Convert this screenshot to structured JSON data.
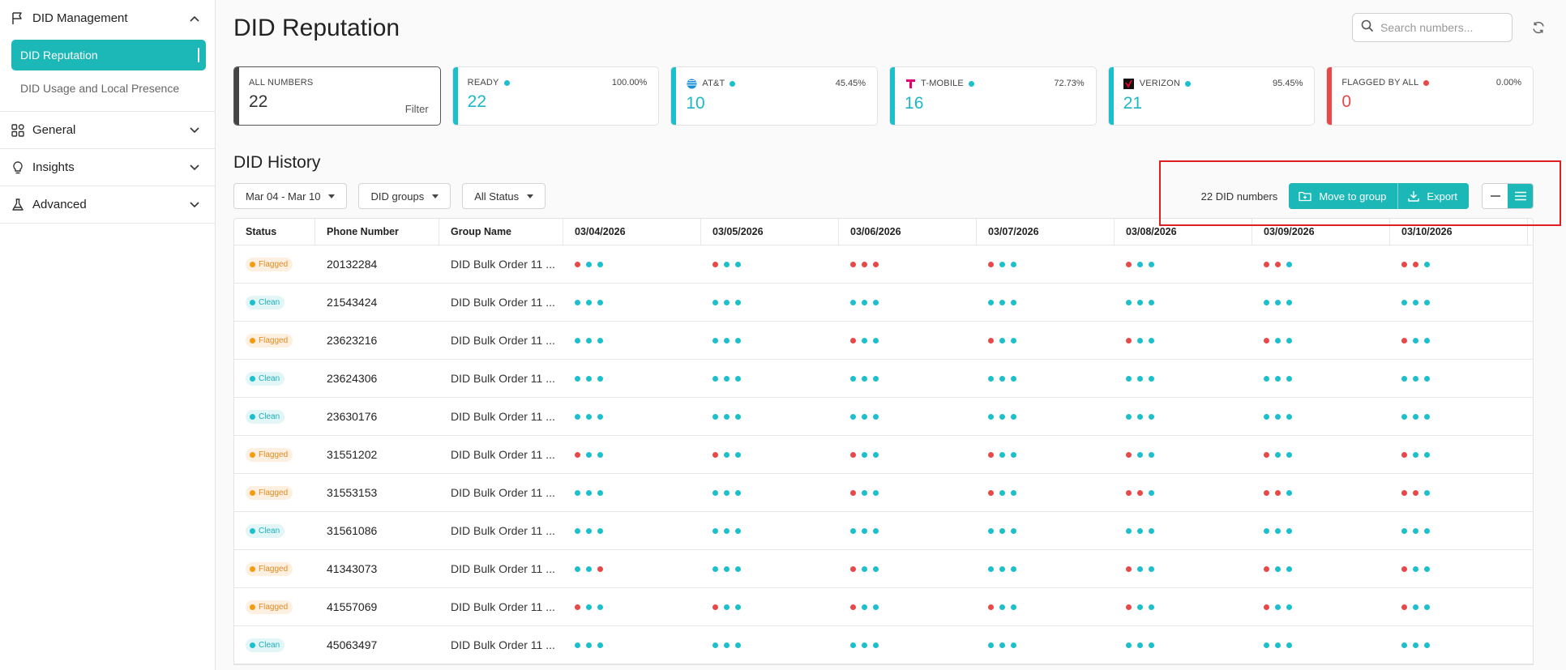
{
  "sidebar": {
    "groups": [
      {
        "label": "DID Management",
        "icon": "flag-icon",
        "expanded": true,
        "items": [
          {
            "label": "DID Reputation",
            "active": true
          },
          {
            "label": "DID Usage and Local Presence",
            "active": false
          }
        ]
      },
      {
        "label": "General",
        "icon": "grid-icon",
        "expanded": false
      },
      {
        "label": "Insights",
        "icon": "lightbulb-icon",
        "expanded": false
      },
      {
        "label": "Advanced",
        "icon": "flask-icon",
        "expanded": false
      }
    ]
  },
  "header": {
    "title": "DID Reputation",
    "search_placeholder": "Search numbers..."
  },
  "cards": [
    {
      "label": "ALL NUMBERS",
      "value": "22",
      "pct": "",
      "action": "Filter",
      "bar": "#444444",
      "dot": "",
      "value_color": "#333333",
      "logo": ""
    },
    {
      "label": "READY",
      "value": "22",
      "pct": "100.00%",
      "bar": "#1cc0cc",
      "dot": "#1cc0cc",
      "value_color": "#1cb8c8",
      "logo": ""
    },
    {
      "label": "AT&T",
      "value": "10",
      "pct": "45.45%",
      "bar": "#1cc0cc",
      "dot": "#1cc0cc",
      "value_color": "#1cb8c8",
      "logo": "att-logo"
    },
    {
      "label": "T-MOBILE",
      "value": "16",
      "pct": "72.73%",
      "bar": "#1cc0cc",
      "dot": "#1cc0cc",
      "value_color": "#1cb8c8",
      "logo": "tmobile-logo"
    },
    {
      "label": "VERIZON",
      "value": "21",
      "pct": "95.45%",
      "bar": "#1cc0cc",
      "dot": "#1cc0cc",
      "value_color": "#1cb8c8",
      "logo": "verizon-logo"
    },
    {
      "label": "FLAGGED BY ALL",
      "value": "0",
      "pct": "0.00%",
      "bar": "#e84848",
      "dot": "#e84848",
      "value_color": "#e84848",
      "logo": ""
    }
  ],
  "history": {
    "title": "DID History",
    "filters": [
      "Mar 04 - Mar 10",
      "DID groups",
      "All Status"
    ],
    "count_label": "22 DID numbers",
    "move_label": "Move to group",
    "export_label": "Export"
  },
  "table": {
    "columns": [
      "Status",
      "Phone Number",
      "Group Name",
      "03/04/2026",
      "03/05/2026",
      "03/06/2026",
      "03/07/2026",
      "03/08/2026",
      "03/09/2026",
      "03/10/2026"
    ],
    "rows": [
      {
        "status": "Flagged",
        "phone": "20132284",
        "group": "DID Bulk Order 11 ...",
        "dots": [
          "rcc",
          "rcc",
          "rrr",
          "rcc",
          "rcc",
          "rrc",
          "rrc"
        ]
      },
      {
        "status": "Clean",
        "phone": "21543424",
        "group": "DID Bulk Order 11 ...",
        "dots": [
          "ccc",
          "ccc",
          "ccc",
          "ccc",
          "ccc",
          "ccc",
          "ccc"
        ]
      },
      {
        "status": "Flagged",
        "phone": "23623216",
        "group": "DID Bulk Order 11 ...",
        "dots": [
          "ccc",
          "ccc",
          "rcc",
          "rcc",
          "rcc",
          "rcc",
          "rcc"
        ]
      },
      {
        "status": "Clean",
        "phone": "23624306",
        "group": "DID Bulk Order 11 ...",
        "dots": [
          "ccc",
          "ccc",
          "ccc",
          "ccc",
          "ccc",
          "ccc",
          "ccc"
        ]
      },
      {
        "status": "Clean",
        "phone": "23630176",
        "group": "DID Bulk Order 11 ...",
        "dots": [
          "ccc",
          "ccc",
          "ccc",
          "ccc",
          "ccc",
          "ccc",
          "ccc"
        ]
      },
      {
        "status": "Flagged",
        "phone": "31551202",
        "group": "DID Bulk Order 11 ...",
        "dots": [
          "rcc",
          "rcc",
          "rcc",
          "rcc",
          "rcc",
          "rcc",
          "rcc"
        ]
      },
      {
        "status": "Flagged",
        "phone": "31553153",
        "group": "DID Bulk Order 11 ...",
        "dots": [
          "ccc",
          "ccc",
          "rcc",
          "rcc",
          "rrc",
          "rrc",
          "rrc"
        ]
      },
      {
        "status": "Clean",
        "phone": "31561086",
        "group": "DID Bulk Order 11 ...",
        "dots": [
          "ccc",
          "ccc",
          "ccc",
          "ccc",
          "ccc",
          "ccc",
          "ccc"
        ]
      },
      {
        "status": "Flagged",
        "phone": "41343073",
        "group": "DID Bulk Order 11 ...",
        "dots": [
          "ccr",
          "ccc",
          "rcc",
          "ccc",
          "rcc",
          "rcc",
          "rcc"
        ]
      },
      {
        "status": "Flagged",
        "phone": "41557069",
        "group": "DID Bulk Order 11 ...",
        "dots": [
          "rcc",
          "rcc",
          "rcc",
          "rcc",
          "rcc",
          "rcc",
          "rcc"
        ]
      },
      {
        "status": "Clean",
        "phone": "45063497",
        "group": "DID Bulk Order 11 ...",
        "dots": [
          "ccc",
          "ccc",
          "ccc",
          "ccc",
          "ccc",
          "ccc",
          "ccc"
        ]
      }
    ]
  },
  "colors": {
    "accent": "#1cb8b8",
    "flag": "#e84848",
    "clean": "#1cc0cc"
  }
}
